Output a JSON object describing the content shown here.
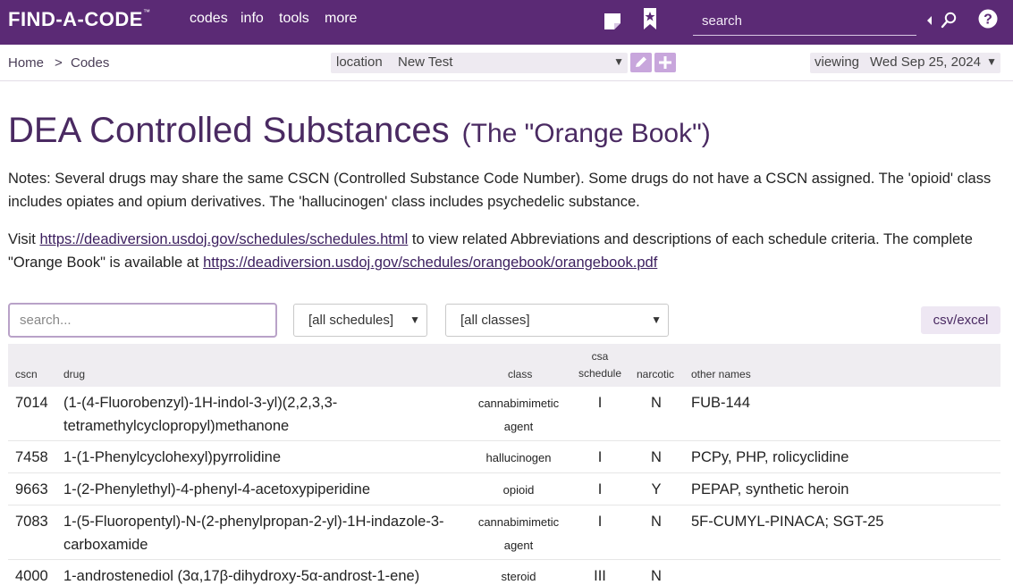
{
  "header": {
    "logo": "FIND-A-CODE",
    "logo_tm": "™",
    "nav": [
      "codes",
      "info",
      "tools",
      "more"
    ],
    "search_placeholder": "search"
  },
  "subbar": {
    "breadcrumb": [
      "Home",
      ">",
      "Codes"
    ],
    "location_label": "location",
    "location_value": "New Test",
    "viewing_label": "viewing",
    "viewing_value": "Wed Sep 25, 2024"
  },
  "page": {
    "title": "DEA Controlled Substances",
    "subtitle": "(The \"Orange Book\")",
    "notes": "Notes:  Several drugs may share the same CSCN (Controlled Substance Code Number). Some drugs do not have a CSCN assigned. The 'opioid' class includes opiates and opium derivatives. The 'hallucinogen' class includes psychedelic substance.",
    "visit_pre": "Visit ",
    "link1": "https://deadiversion.usdoj.gov/schedules/schedules.html",
    "visit_mid": " to view related Abbreviations and descriptions of each schedule criteria. The complete \"Orange Book\" is available at ",
    "link2": "https://deadiversion.usdoj.gov/schedules/orangebook/orangebook.pdf"
  },
  "filters": {
    "search_placeholder": "search...",
    "schedules": "[all schedules]",
    "classes": "[all classes]",
    "export": "csv/excel"
  },
  "table": {
    "headers": {
      "cscn": "cscn",
      "drug": "drug",
      "class": "class",
      "csa_1": "csa",
      "csa_2": "schedule",
      "narcotic": "narcotic",
      "other": "other names"
    },
    "rows": [
      {
        "cscn": "7014",
        "drug": "(1-(4-Fluorobenzyl)-1H-indol-3-yl)(2,2,3,3-tetramethylcyclopropyl)methanone",
        "class": "cannabimimetic agent",
        "schedule": "I",
        "narcotic": "N",
        "other": "FUB-144"
      },
      {
        "cscn": "7458",
        "drug": "1-(1-Phenylcyclohexyl)pyrrolidine",
        "class": "hallucinogen",
        "schedule": "I",
        "narcotic": "N",
        "other": "PCPy, PHP, rolicyclidine"
      },
      {
        "cscn": "9663",
        "drug": "1-(2-Phenylethyl)-4-phenyl-4-acetoxypiperidine",
        "class": "opioid",
        "schedule": "I",
        "narcotic": "Y",
        "other": "PEPAP, synthetic heroin"
      },
      {
        "cscn": "7083",
        "drug": "1-(5-Fluoropentyl)-N-(2-phenylpropan-2-yl)-1H-indazole-3-carboxamide",
        "class": "cannabimimetic agent",
        "schedule": "I",
        "narcotic": "N",
        "other": "5F-CUMYL-PINACA; SGT-25"
      },
      {
        "cscn": "4000",
        "drug": "1-androstenediol (3α,17β-dihydroxy-5α-androst-1-ene)",
        "class": "steroid",
        "schedule": "III",
        "narcotic": "N",
        "other": ""
      }
    ]
  }
}
